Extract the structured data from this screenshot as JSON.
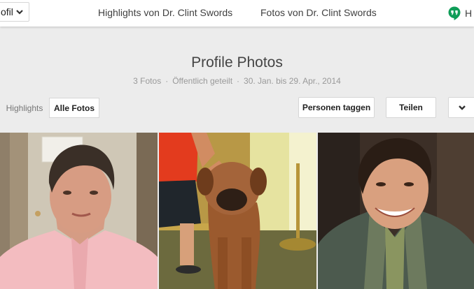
{
  "topbar": {
    "profile_select_label": "ofil",
    "nav": [
      "Highlights von Dr. Clint Swords",
      "Fotos von Dr. Clint Swords"
    ],
    "hangouts_label": "H",
    "hangouts_color": "#0f9d58"
  },
  "album": {
    "title": "Profile Photos",
    "photo_count": "3 Fotos",
    "visibility": "Öffentlich geteilt",
    "date_range": "30. Jan. bis 29. Apr., 2014"
  },
  "toolbar": {
    "highlights_label": "Highlights",
    "all_photos_label": "Alle Fotos",
    "tag_people_label": "Personen taggen",
    "share_label": "Teilen"
  },
  "icons": {
    "profile_chevron": "chevron-down-icon",
    "hangouts": "hangouts-icon",
    "more": "chevron-down-icon"
  }
}
